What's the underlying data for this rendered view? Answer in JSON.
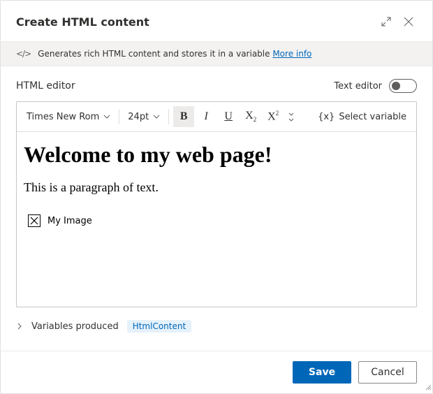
{
  "header": {
    "title": "Create HTML content"
  },
  "infoBar": {
    "text": "Generates rich HTML content and stores it in a variable ",
    "linkText": "More info"
  },
  "editor": {
    "sectionLabel": "HTML editor",
    "toggleLabel": "Text editor",
    "font": {
      "name": "Times New Rom",
      "size": "24pt"
    },
    "buttons": {
      "bold": "B",
      "italic": "I",
      "underline": "U",
      "subscript_base": "X",
      "superscript_base": "X",
      "selectVariable": "Select variable",
      "varGlyph": "{x}"
    },
    "content": {
      "heading": "Welcome to my web page!",
      "paragraph": "This is a paragraph of text.",
      "imageAlt": "My Image"
    }
  },
  "variablesProduced": {
    "label": "Variables produced",
    "pill": "HtmlContent"
  },
  "footer": {
    "save": "Save",
    "cancel": "Cancel"
  }
}
